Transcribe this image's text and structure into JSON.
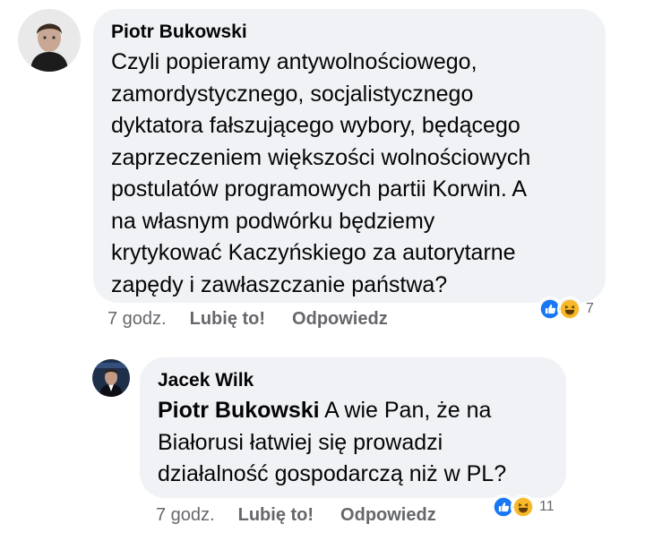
{
  "comments": [
    {
      "author": "Piotr Bukowski",
      "text": "Czyli popieramy antywolnościowego,\nzamordystycznego, socjalistycznego\ndyktatora fałszującego wybory, będącego\nzaprzeczeniem większości wolnościowych\npostulatów programowych partii Korwin. A\nna własnym podwórku będziemy\nkrytykować Kaczyńskiego za autorytarne\nzapędy i zawłaszczanie państwa?",
      "time": "7 godz.",
      "like_label": "Lubię to!",
      "reply_label": "Odpowiedz",
      "reaction_count": "7",
      "reaction_icons": [
        "like-icon",
        "haha-icon"
      ]
    },
    {
      "author": "Jacek Wilk",
      "mention": "Piotr Bukowski",
      "text": "A wie Pan, że na\nBiałorusi łatwiej się prowadzi\ndziałalność gospodarczą niż w PL?",
      "time": "7 godz.",
      "like_label": "Lubię to!",
      "reply_label": "Odpowiedz",
      "reaction_count": "11",
      "reaction_icons": [
        "like-icon",
        "haha-icon"
      ]
    }
  ],
  "colors": {
    "bubble": "#f0f2f5",
    "meta_text": "#65676b",
    "like_blue": "#1877f2",
    "haha_yellow": "#f7b928"
  }
}
